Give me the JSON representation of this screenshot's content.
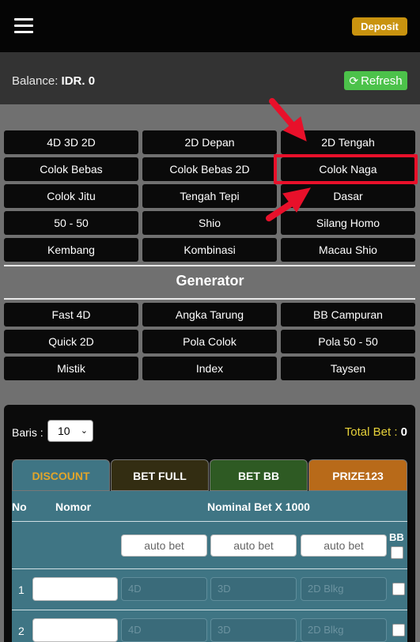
{
  "header": {
    "deposit_label": "Deposit"
  },
  "balance": {
    "label": "Balance:",
    "value": "IDR. 0",
    "refresh_label": "Refresh"
  },
  "games": [
    "4D 3D 2D",
    "2D Depan",
    "2D Tengah",
    "Colok Bebas",
    "Colok Bebas 2D",
    "Colok Naga",
    "Colok Jitu",
    "Tengah Tepi",
    "Dasar",
    "50 - 50",
    "Shio",
    "Silang Homo",
    "Kembang",
    "Kombinasi",
    "Macau Shio"
  ],
  "generator": {
    "title": "Generator",
    "items": [
      "Fast 4D",
      "Angka Tarung",
      "BB Campuran",
      "Quick 2D",
      "Pola Colok",
      "Pola 50 - 50",
      "Mistik",
      "Index",
      "Taysen"
    ]
  },
  "bet_panel": {
    "baris_label": "Baris :",
    "baris_value": "10",
    "total_bet_label": "Total Bet :",
    "total_bet_value": "0",
    "tabs": [
      "DISCOUNT",
      "BET FULL",
      "BET BB",
      "PRIZE123"
    ],
    "columns": {
      "no": "No",
      "nomor": "Nomor",
      "nominal": "Nominal Bet X 1000",
      "bb": "BB"
    },
    "auto_bet_placeholder": "auto bet",
    "rows": [
      {
        "no": "1",
        "ph4d": "4D",
        "ph3d": "3D",
        "ph2d": "2D Blkg"
      },
      {
        "no": "2",
        "ph4d": "4D",
        "ph3d": "3D",
        "ph2d": "2D Blkg"
      }
    ]
  },
  "colors": {
    "deposit": "#c9930f",
    "refresh": "#4cc24a",
    "highlight": "#e8102a",
    "tab_discount": "#3f7584",
    "tab_betfull": "#332d12",
    "tab_betbb": "#2e5a23",
    "tab_prize": "#b86a19"
  }
}
